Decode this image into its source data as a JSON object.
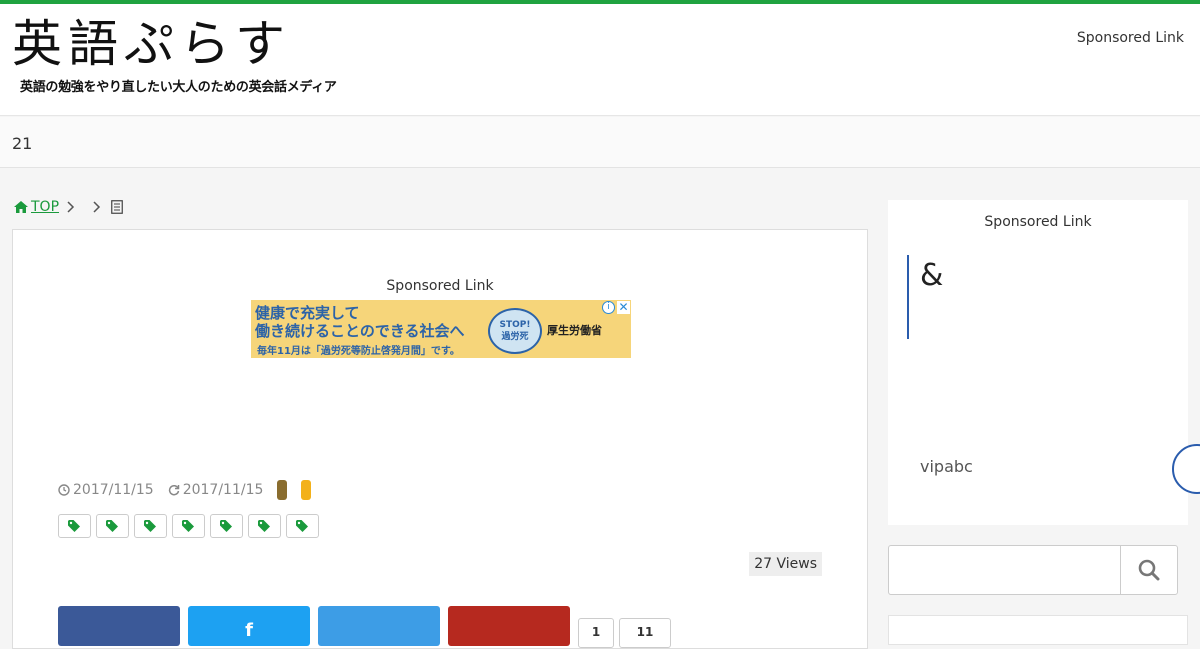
{
  "theme": {
    "accent": "#1fa340",
    "link": "#1a9a3c",
    "blue": "#2a5cad"
  },
  "header": {
    "logo_main": "英語ぷらす",
    "logo_sub": "英語の勉強をやり直したい大人のための英会話メディア",
    "sponsored": "Sponsored Link"
  },
  "nav": {
    "text": "21"
  },
  "breadcrumb": {
    "home_label": "TOP",
    "home_icon": "home-icon",
    "doc_icon": "document-icon"
  },
  "article": {
    "sponsored": "Sponsored Link",
    "ad": {
      "line1": "健康で充実して",
      "line2": "働き続けることのできる社会へ",
      "line3": "毎年11月は「過労死等防止啓発月間」です。",
      "badge_top": "STOP!",
      "badge_bottom": "過労死",
      "sponsor": "厚生労働省",
      "info": "i",
      "close": "✕"
    },
    "published": "2017/11/15",
    "updated": "2017/11/15",
    "category_colors": [
      "#8a6d2f",
      "#f3b11a"
    ],
    "tag_count": 7,
    "views": "27 Views",
    "share": [
      {
        "name": "facebook",
        "color": "#3b5998",
        "label": ""
      },
      {
        "name": "twitter",
        "color": "#1da1f2",
        "label": "f"
      },
      {
        "name": "hatena",
        "color": "#3d9de6",
        "label": ""
      },
      {
        "name": "pocket",
        "color": "#b6291f",
        "label": ""
      }
    ],
    "share_mini": [
      "1",
      "11"
    ]
  },
  "sidebar": {
    "sponsored": "Sponsored Link",
    "amp": "&",
    "brand": "vipabc"
  },
  "search": {
    "placeholder": "",
    "icon": "search-icon"
  }
}
